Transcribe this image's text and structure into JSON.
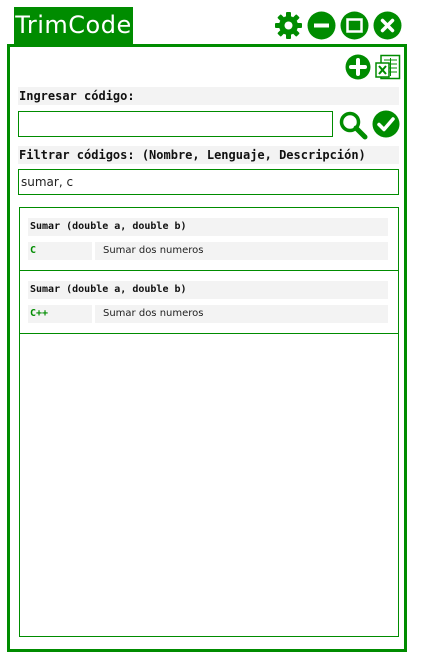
{
  "app": {
    "title": "TrimCode",
    "brand_color": "#008c00"
  },
  "window_controls": [
    {
      "name": "settings",
      "icon": "gear-icon"
    },
    {
      "name": "minimize",
      "icon": "minus-circle-icon"
    },
    {
      "name": "maximize",
      "icon": "square-icon"
    },
    {
      "name": "close",
      "icon": "close-circle-icon"
    }
  ],
  "toolbar": {
    "add_icon": "plus-circle-icon",
    "excel_icon": "excel-export-icon"
  },
  "code_entry": {
    "label": "Ingresar código:",
    "value": "",
    "placeholder": "",
    "search_icon": "search-icon",
    "confirm_icon": "check-circle-icon"
  },
  "filter": {
    "label": "Filtrar códigos: (Nombre, Lenguaje, Descripción)",
    "value": "sumar, c"
  },
  "results": [
    {
      "title": "Sumar (double a,  double b)",
      "language": "C",
      "description": "Sumar dos numeros"
    },
    {
      "title": "Sumar (double a,  double b)",
      "language": "C++",
      "description": "Sumar dos numeros"
    }
  ]
}
